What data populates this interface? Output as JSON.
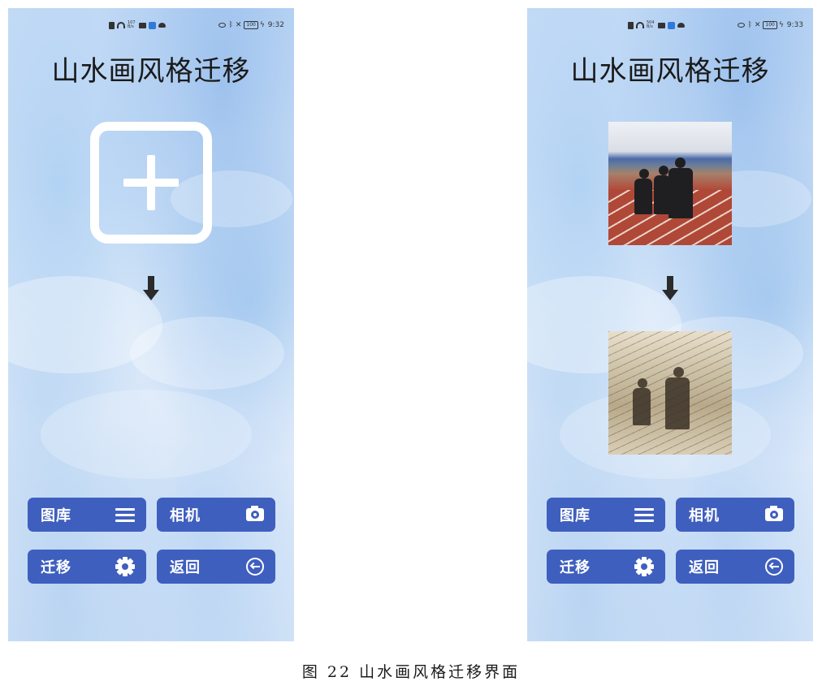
{
  "screens": [
    {
      "status": {
        "speed": "107 B/s",
        "battery": "100",
        "time": "9:32"
      },
      "title": "山水画风格迁移",
      "buttons": {
        "gallery": "图库",
        "camera": "相机",
        "transfer": "迁移",
        "back": "返回"
      }
    },
    {
      "status": {
        "speed": "504 B/s",
        "battery": "100",
        "time": "9:33"
      },
      "title": "山水画风格迁移",
      "buttons": {
        "gallery": "图库",
        "camera": "相机",
        "transfer": "迁移",
        "back": "返回"
      }
    }
  ],
  "icons": {
    "add": "plus-icon",
    "arrow": "arrow-down-icon",
    "gallery": "menu-icon",
    "camera": "camera-icon",
    "transfer": "gear-icon",
    "back": "arrow-left-circle-icon"
  },
  "colors": {
    "button": "#3f5fbf",
    "background": "#d6e6f8"
  },
  "caption": "图 22  山水画风格迁移界面"
}
